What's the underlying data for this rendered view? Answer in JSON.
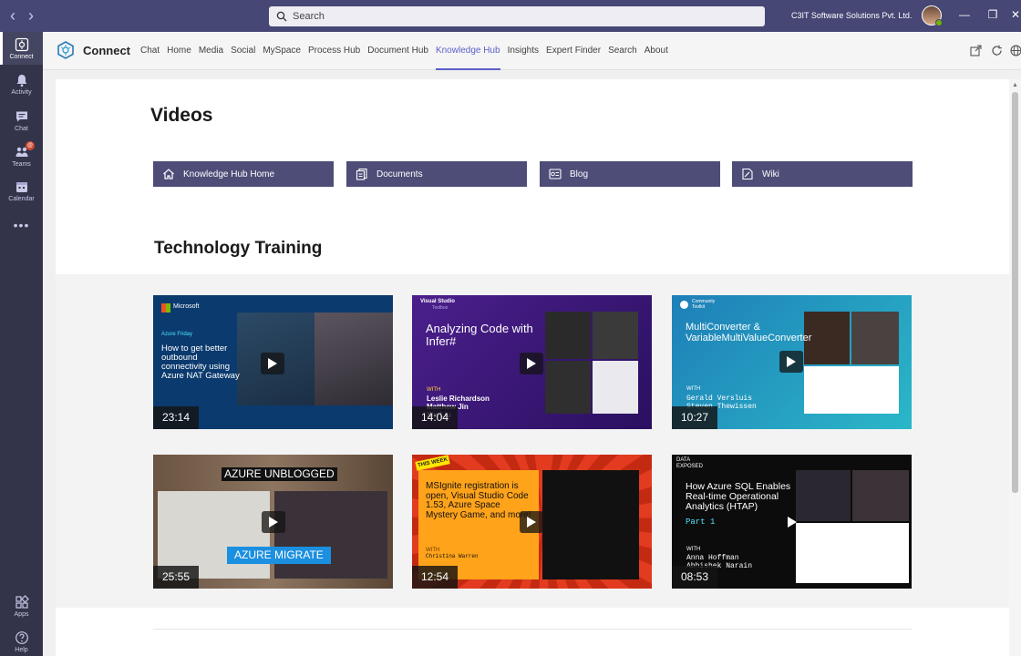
{
  "window": {
    "search_placeholder": "Search",
    "org_name": "C3IT Software Solutions Pvt. Ltd.",
    "controls": {
      "minimize": "—",
      "restore": "❐",
      "close": "✕"
    }
  },
  "rail": {
    "items": [
      {
        "label": "Connect",
        "icon": "connect-app-icon"
      },
      {
        "label": "Activity",
        "icon": "bell-icon"
      },
      {
        "label": "Chat",
        "icon": "chat-icon"
      },
      {
        "label": "Teams",
        "icon": "teams-icon",
        "badge": "@"
      },
      {
        "label": "Calendar",
        "icon": "calendar-icon"
      },
      {
        "label": "Apps",
        "icon": "apps-icon"
      },
      {
        "label": "Help",
        "icon": "help-icon"
      }
    ]
  },
  "appbar": {
    "app_name": "Connect",
    "tabs": [
      "Chat",
      "Home",
      "Media",
      "Social",
      "MySpace",
      "Process Hub",
      "Document Hub",
      "Knowledge Hub",
      "Insights",
      "Expert Finder",
      "Search",
      "About"
    ],
    "active_tab": "Knowledge Hub"
  },
  "page": {
    "title": "Videos",
    "quick_links": [
      {
        "label": "Knowledge Hub Home",
        "icon": "home-icon"
      },
      {
        "label": "Documents",
        "icon": "documents-icon"
      },
      {
        "label": "Blog",
        "icon": "blog-icon"
      },
      {
        "label": "Wiki",
        "icon": "wiki-icon"
      }
    ],
    "section_title": "Technology Training",
    "videos": [
      {
        "brand": "Microsoft",
        "show": "Azure Friday",
        "title": "How to get better outbound connectivity using Azure NAT Gateway",
        "duration": "23:14"
      },
      {
        "brand": "Visual Studio",
        "brand_sub": "Toolbox",
        "title": "Analyzing Code with Infer#",
        "with": "WITH",
        "names": "Leslie Richardson\nMatthew Jin\nXin Liu",
        "duration": "14:04"
      },
      {
        "brand": "Community",
        "brand_sub": "Toolkit",
        "title": "MultiConverter & VariableMultiValueConverter",
        "with": "WITH",
        "names": "Gerald Versluis\nSteven Thewissen",
        "duration": "10:27"
      },
      {
        "title": "AZURE UNBLOGGED",
        "subtitle": "AZURE MIGRATE",
        "duration": "25:55"
      },
      {
        "brand": "THIS WEEK",
        "title": "MSIgnite registration is open, Visual Studio Code 1.53, Azure Space Mystery Game, and more!",
        "with": "WITH",
        "names": "Christina Warren",
        "duration": "12:54"
      },
      {
        "brand": "DATA EXPOSED",
        "title": "How Azure SQL Enables Real-time Operational Analytics (HTAP)",
        "part": "Part 1",
        "with": "WITH",
        "names": "Anna Hoffman\nAbhishek Narain",
        "duration": "08:53"
      }
    ]
  }
}
